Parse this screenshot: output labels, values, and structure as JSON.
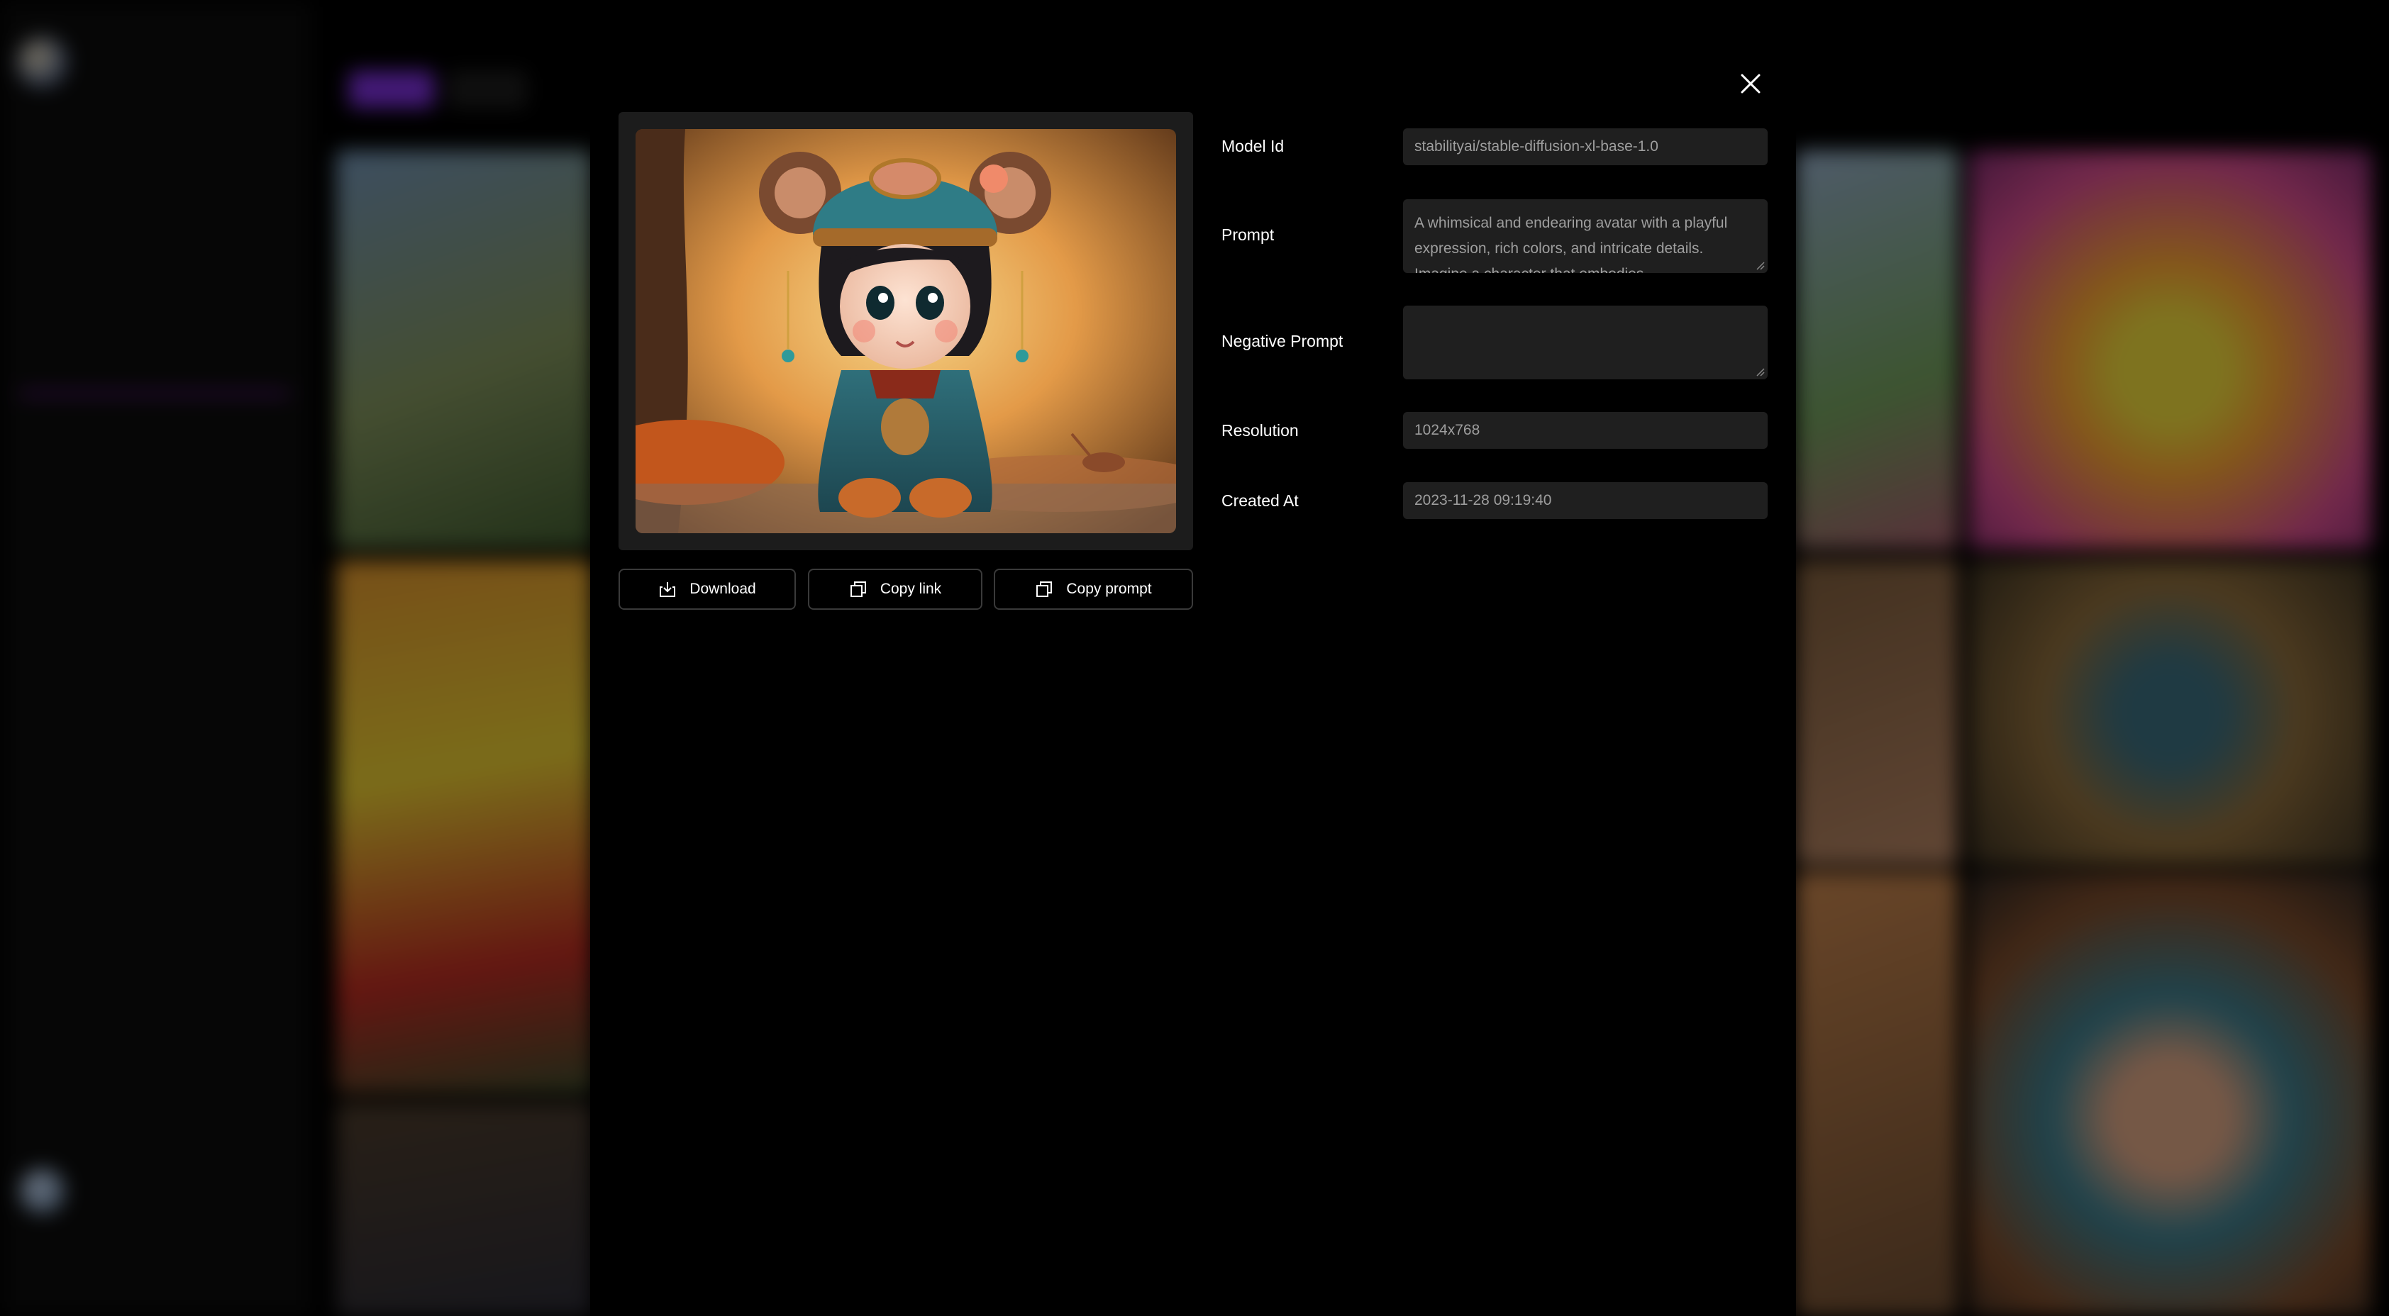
{
  "modal": {
    "close_icon": "close-icon",
    "fields": {
      "model_id": {
        "label": "Model Id",
        "value": "stabilityai/stable-diffusion-xl-base-1.0"
      },
      "prompt": {
        "label": "Prompt",
        "value": "A whimsical and endearing avatar with a playful expression, rich colors, and intricate details. Imagine a character that embodies"
      },
      "negative_prompt": {
        "label": "Negative Prompt",
        "value": ""
      },
      "resolution": {
        "label": "Resolution",
        "value": "1024x768"
      },
      "created_at": {
        "label": "Created At",
        "value": "2023-11-28 09:19:40"
      }
    },
    "actions": {
      "download": {
        "label": "Download",
        "icon": "download-icon"
      },
      "copy_link": {
        "label": "Copy link",
        "icon": "copy-icon"
      },
      "copy_prompt": {
        "label": "Copy prompt",
        "icon": "copy-icon"
      }
    }
  },
  "colors": {
    "modal_bg": "#000000",
    "field_bg": "#1f1f1f",
    "field_text": "#9e9e9e",
    "accent": "#7b2fd8"
  }
}
